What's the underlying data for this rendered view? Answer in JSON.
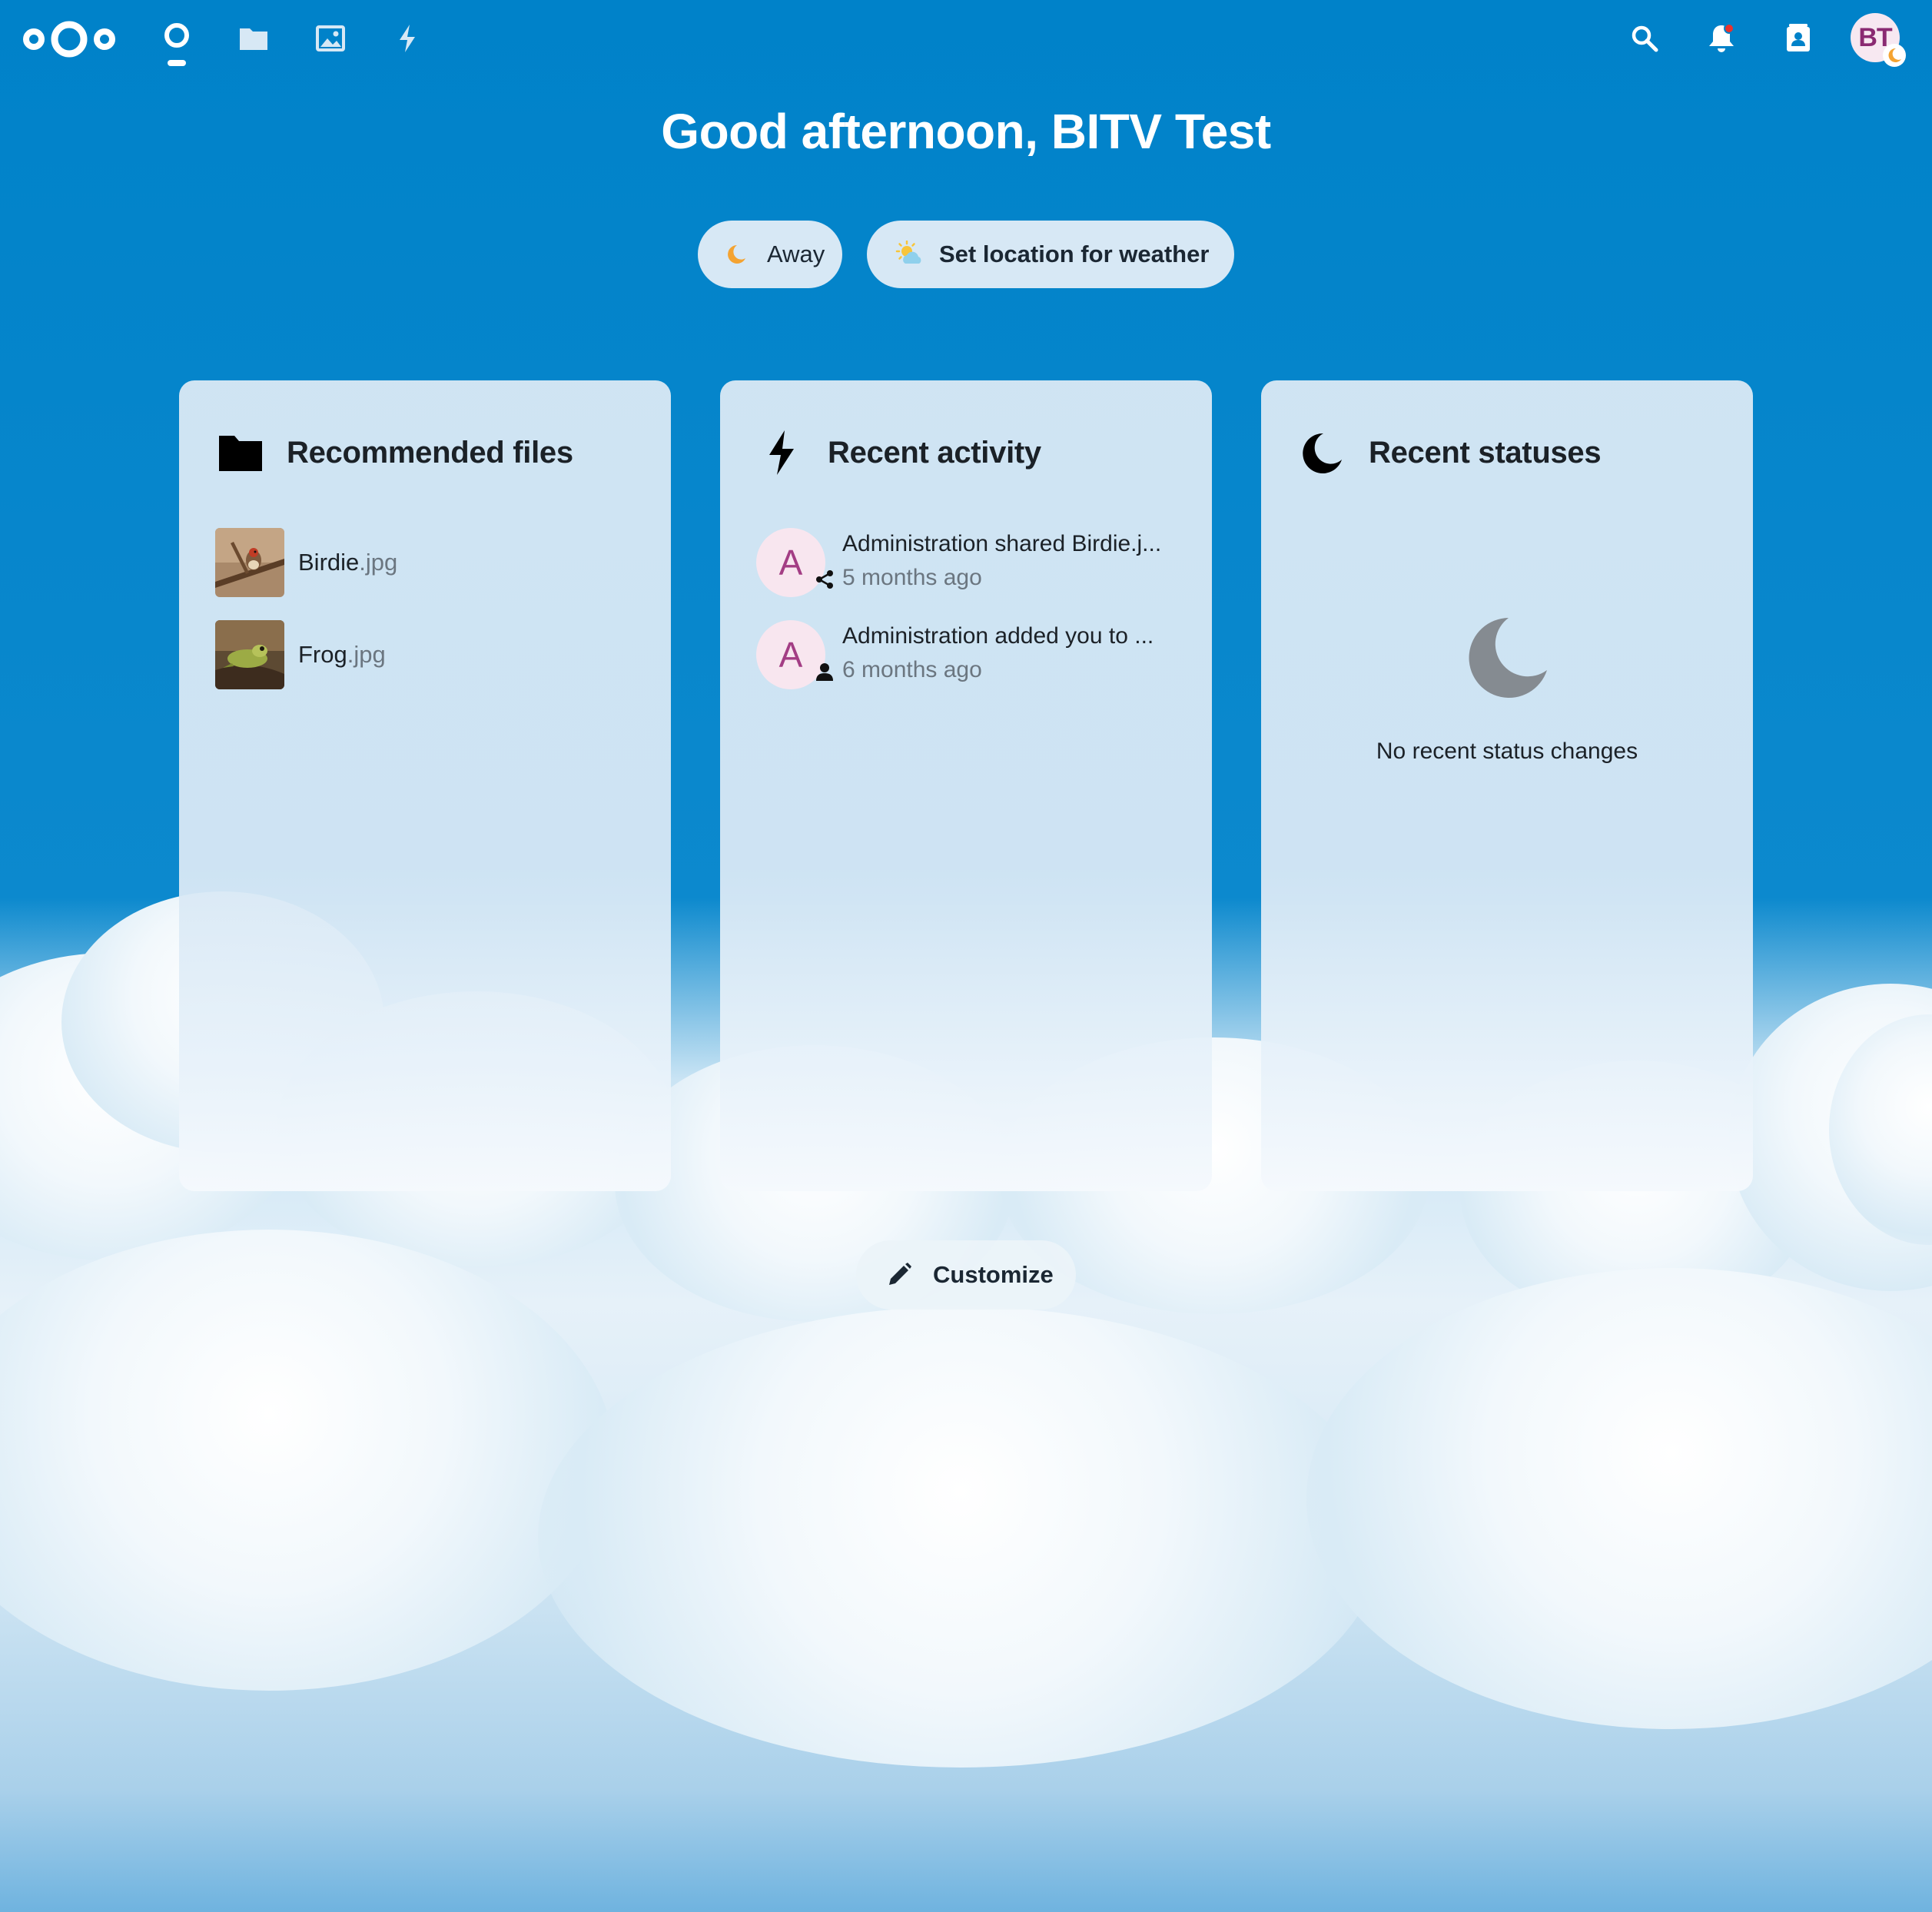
{
  "header": {
    "apps": [
      {
        "name": "Dashboard",
        "icon": "dashboard-icon"
      },
      {
        "name": "Files",
        "icon": "folder-icon"
      },
      {
        "name": "Photos",
        "icon": "image-icon"
      },
      {
        "name": "Activity",
        "icon": "lightning-icon"
      }
    ],
    "right_icons": [
      "search-icon",
      "bell-icon",
      "contacts-icon"
    ],
    "user_initials": "BT"
  },
  "greeting": "Good afternoon, BITV Test",
  "status_pill": {
    "label": "Away"
  },
  "weather_pill": {
    "label": "Set location for weather"
  },
  "widgets": {
    "files": {
      "title": "Recommended files",
      "items": [
        {
          "name": "Birdie",
          "ext": ".jpg"
        },
        {
          "name": "Frog",
          "ext": ".jpg"
        }
      ]
    },
    "activity": {
      "title": "Recent activity",
      "items": [
        {
          "avatar": "A",
          "text": "Administration shared Birdie.j...",
          "time": "5 months ago",
          "badge": "share-icon"
        },
        {
          "avatar": "A",
          "text": "Administration added you to ...",
          "time": "6 months ago",
          "badge": "user-icon"
        }
      ]
    },
    "statuses": {
      "title": "Recent statuses",
      "empty_text": "No recent status changes"
    }
  },
  "customize": {
    "label": "Customize"
  },
  "colors": {
    "background": "#0082c9",
    "card": "#d7e8f5",
    "accent_orange": "#f4a331",
    "avatar_text": "#a33d84"
  }
}
